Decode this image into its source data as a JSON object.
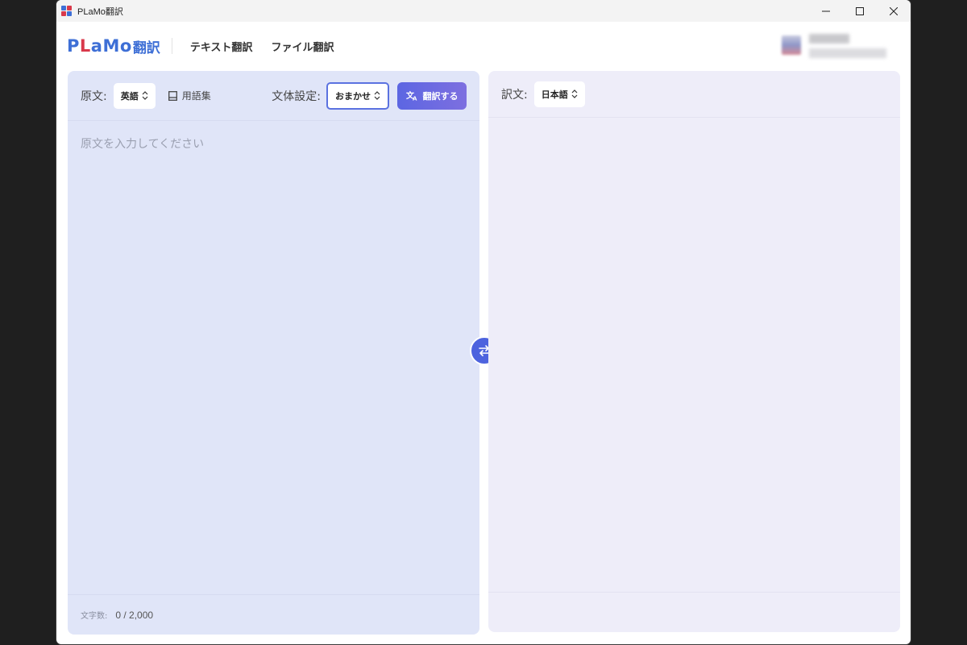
{
  "window": {
    "title": "PLaMo翻訳"
  },
  "header": {
    "logo_latin": "PLaMo",
    "logo_jp": "翻訳",
    "nav": [
      {
        "label": "テキスト翻訳"
      },
      {
        "label": "ファイル翻訳"
      }
    ]
  },
  "source": {
    "label": "原文:",
    "language": "英語",
    "glossary_label": "用語集",
    "style_label": "文体設定:",
    "style_value": "おまかせ",
    "translate_label": "翻訳する",
    "placeholder": "原文を入力してください",
    "char_count_label": "文字数:",
    "char_count": "0 / 2,000"
  },
  "target": {
    "label": "訳文:",
    "language": "日本語"
  },
  "colors": {
    "accent": "#5c66e2",
    "source_panel": "#e0e5f8",
    "target_panel": "#eeedf9",
    "logo_blue": "#3e6fd6",
    "logo_red": "#d9394b"
  },
  "icons": [
    "app-icon",
    "minimize-icon",
    "maximize-icon",
    "close-icon",
    "book-icon",
    "translate-icon",
    "swap-icon",
    "chevron-updown-icon"
  ]
}
